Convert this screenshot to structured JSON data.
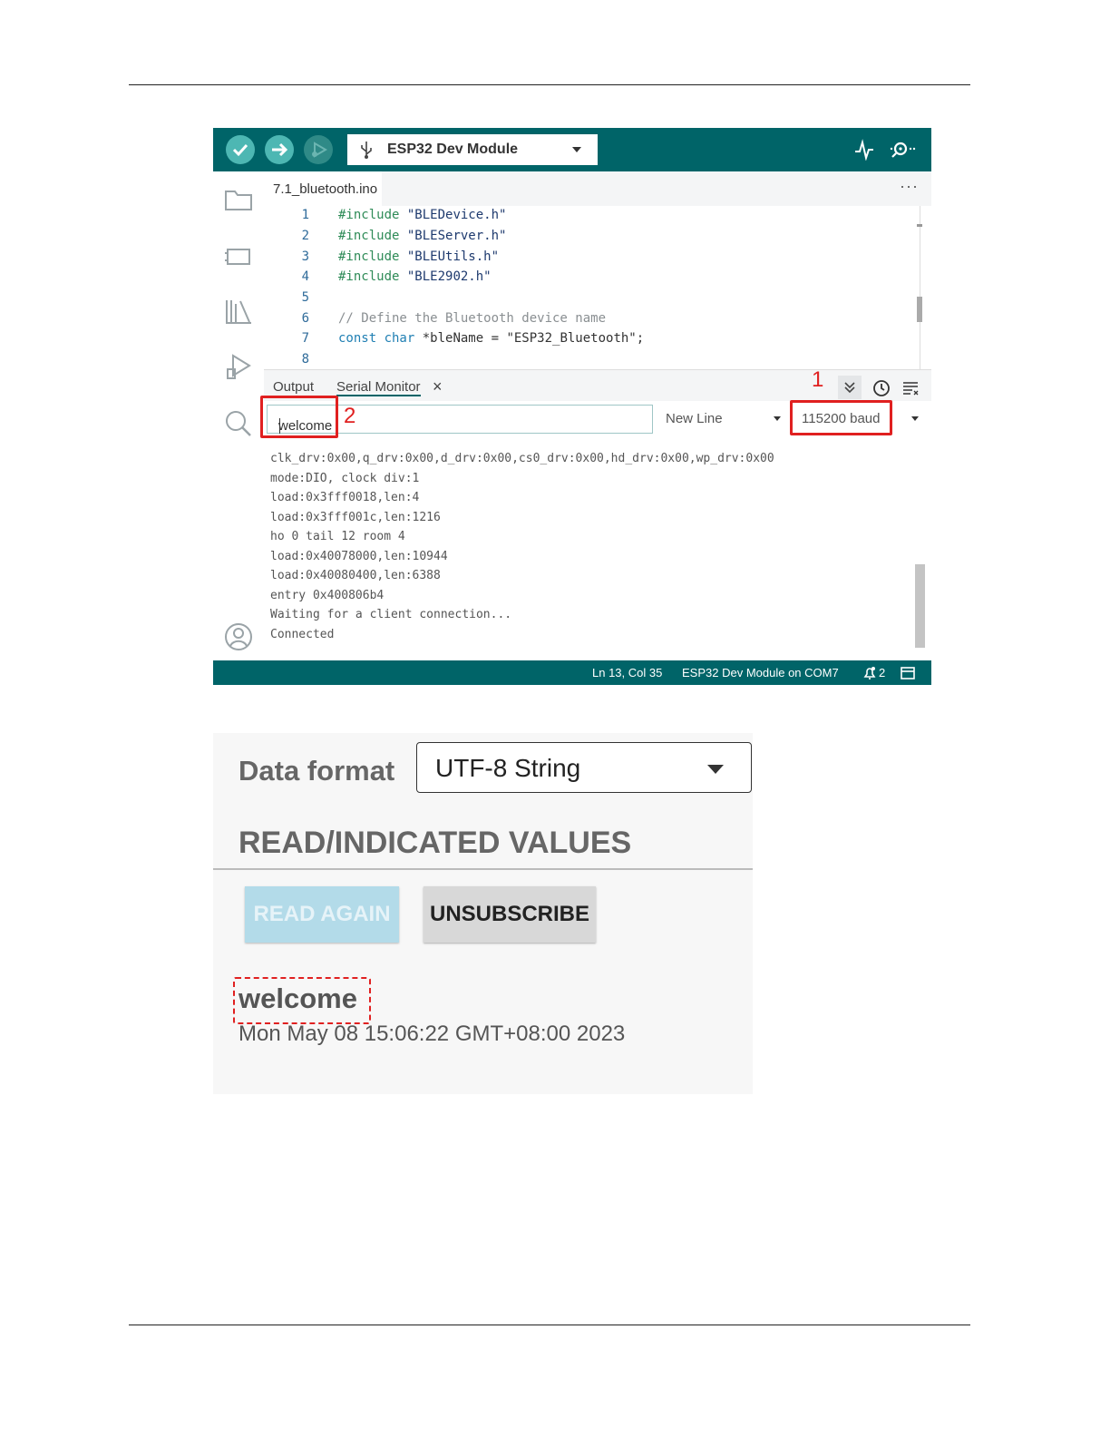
{
  "ide": {
    "board": "ESP32 Dev Module",
    "file_tab": "7.1_bluetooth.ino",
    "more_menu": "···",
    "code": [
      {
        "ln": "1",
        "kw": "#include",
        "rest": " \"BLEDevice.h\""
      },
      {
        "ln": "2",
        "kw": "#include",
        "rest": " \"BLEServer.h\""
      },
      {
        "ln": "3",
        "kw": "#include",
        "rest": " \"BLEUtils.h\""
      },
      {
        "ln": "4",
        "kw": "#include",
        "rest": " \"BLE2902.h\""
      },
      {
        "ln": "5",
        "kw": "",
        "rest": ""
      },
      {
        "ln": "6",
        "comment": "// Define the Bluetooth device name"
      },
      {
        "ln": "7",
        "kw": "const char",
        "rest": " *bleName = \"ESP32_Bluetooth\";"
      },
      {
        "ln": "8",
        "kw": "",
        "rest": ""
      }
    ],
    "panel_tabs": {
      "output": "Output",
      "serial_monitor": "Serial Monitor",
      "close": "×"
    },
    "message_input": "welcome",
    "line_ending": "New Line",
    "baud": "115200 baud",
    "serial_output": [
      "clk_drv:0x00,q_drv:0x00,d_drv:0x00,cs0_drv:0x00,hd_drv:0x00,wp_drv:0x00",
      "mode:DIO, clock div:1",
      "load:0x3fff0018,len:4",
      "load:0x3fff001c,len:1216",
      "ho 0 tail 12 room 4",
      "load:0x40078000,len:10944",
      "load:0x40080400,len:6388",
      "entry 0x400806b4",
      "Waiting for a client connection...",
      "Connected"
    ],
    "status": {
      "position": "Ln 13, Col 35",
      "board_port": "ESP32 Dev Module on COM7",
      "notifications": "2"
    },
    "annotations": {
      "one": "1",
      "two": "2"
    }
  },
  "app": {
    "data_format_label": "Data format",
    "data_format_value": "UTF-8 String",
    "section_title": "READ/INDICATED VALUES",
    "read_again": "READ AGAIN",
    "unsubscribe": "UNSUBSCRIBE",
    "value": "welcome",
    "timestamp": "Mon May 08 15:06:22 GMT+08:00 2023"
  },
  "colors": {
    "ide_teal": "#006468",
    "highlight_red": "#e02020"
  }
}
